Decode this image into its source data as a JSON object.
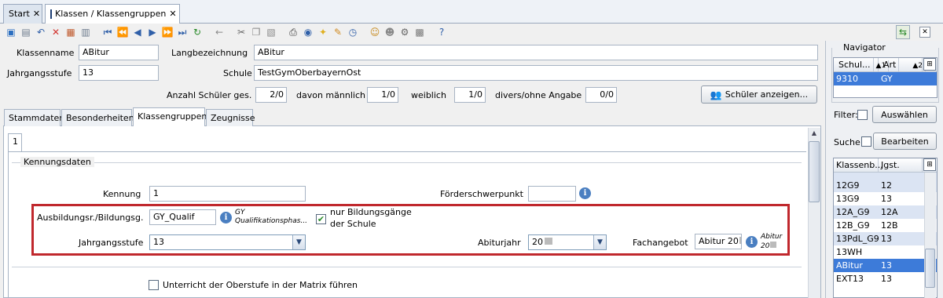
{
  "tabs": [
    {
      "label": "Start",
      "active": false
    },
    {
      "label": "Klassen / Klassengruppen",
      "active": true
    }
  ],
  "toolbar_icons": [
    "new-icon",
    "save-icon",
    "undo-icon",
    "delete-icon",
    "delete-list-icon",
    "copy-record-icon",
    "first-icon",
    "prev-page-icon",
    "prev-icon",
    "next-icon",
    "next-page-icon",
    "last-icon",
    "refresh-icon",
    "back-arrow-icon",
    "cut-icon",
    "copy-icon",
    "paste-icon",
    "print-icon",
    "preview-icon",
    "hint-icon",
    "tools-icon",
    "clock-icon",
    "users-icon",
    "user-icon",
    "settings-icon",
    "export-icon",
    "help-icon"
  ],
  "header": {
    "klassenname_label": "Klassenname",
    "klassenname_value": "ABitur",
    "langbez_label": "Langbezeichnung",
    "langbez_value": "ABitur",
    "jahrgang_label": "Jahrgangsstufe",
    "jahrgang_value": "13",
    "schule_label": "Schule",
    "schule_value": "TestGymOberbayernOst",
    "anzahl_label": "Anzahl Schüler ges.",
    "anzahl_value": "2/0",
    "maennlich_label": "davon männlich",
    "maennlich_value": "1/0",
    "weiblich_label": "weiblich",
    "weiblich_value": "1/0",
    "divers_label": "divers/ohne Angabe",
    "divers_value": "0/0",
    "show_students_button": "Schüler anzeigen..."
  },
  "subtabs": [
    "Stammdaten",
    "Besonderheiten",
    "Klassengruppen",
    "Zeugnisse"
  ],
  "active_subtab": "Klassengruppen",
  "group_tab": "1",
  "kennungsdaten": {
    "section_label": "Kennungsdaten",
    "kennung_label": "Kennung",
    "kennung_value": "1",
    "foerder_label": "Förderschwerpunkt",
    "foerder_value": "",
    "ausbildung_label": "Ausbildungsr./Bildungsg.",
    "ausbildung_value": "GY_Qualif",
    "ausbildung_desc_line1": "GY",
    "ausbildung_desc_line2": "Qualifikationsphas...",
    "nur_bildung_line1": "nur Bildungsgänge",
    "nur_bildung_line2": "der Schule",
    "nur_bildung_checked": true,
    "jahrgang_label": "Jahrgangsstufe",
    "jahrgang_value": "13",
    "abiturjahr_label": "Abiturjahr",
    "abiturjahr_value": "20",
    "fachangebot_label": "Fachangebot",
    "fachangebot_value": "Abitur 20",
    "fachangebot_desc_line1": "Abitur",
    "fachangebot_desc_line2": "20",
    "matrix_label": "Unterricht der Oberstufe in der Matrix führen",
    "matrix_checked": false
  },
  "navigator": {
    "title": "Navigator",
    "col1": "Schul...",
    "col1_sort": "▲1",
    "col2": "Art",
    "col2_sort": "▲2",
    "row_schulnr": "9310",
    "row_art": "GY",
    "filter_label": "Filter:",
    "auswaehlen_button": "Auswählen",
    "suche_label": "Suche:",
    "bearbeiten_button": "Bearbeiten",
    "list_col1": "Klassenb...",
    "list_col2": "Jgst.",
    "rows": [
      {
        "k": "12G9",
        "j": "12",
        "style": "alt"
      },
      {
        "k": "13G9",
        "j": "13",
        "style": ""
      },
      {
        "k": "12A_G9",
        "j": "12A",
        "style": "alt"
      },
      {
        "k": "12B_G9",
        "j": "12B",
        "style": ""
      },
      {
        "k": "13PdL_G9",
        "j": "13",
        "style": "alt"
      },
      {
        "k": "13WH",
        "j": "",
        "style": ""
      },
      {
        "k": "ABitur",
        "j": "13",
        "style": "sel"
      },
      {
        "k": "EXT13",
        "j": "13",
        "style": ""
      }
    ]
  },
  "colors": {
    "highlight_border": "#c0282d",
    "selection": "#3d7bd9",
    "alt_row": "#dbe4f3"
  }
}
